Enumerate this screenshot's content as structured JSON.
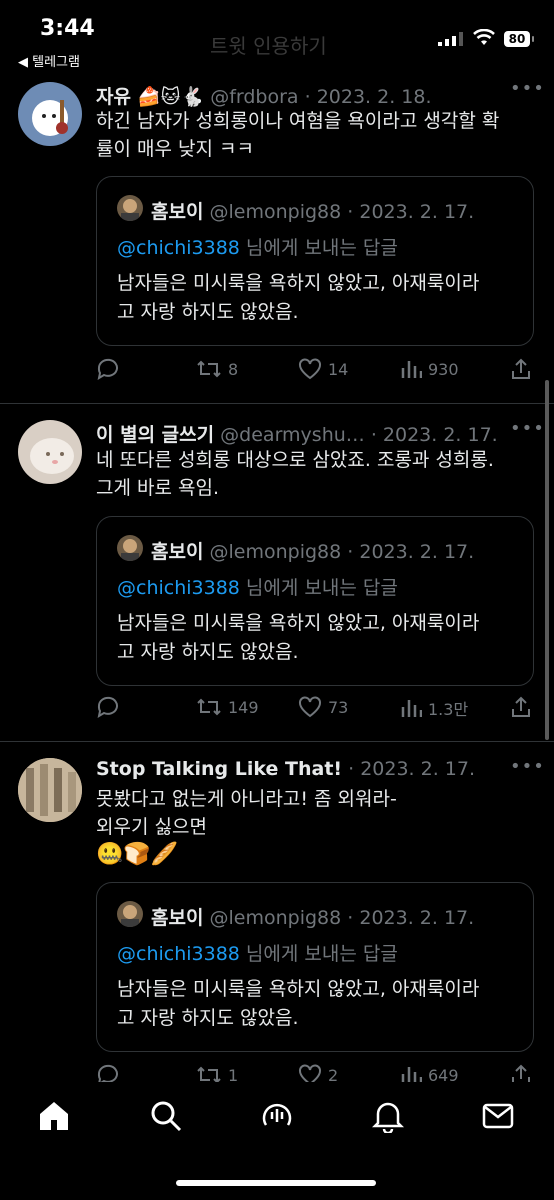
{
  "status_bar": {
    "time": "3:44",
    "back_app": "◀ 텔레그램",
    "battery": "80",
    "faded_title": "트윗 인용하기"
  },
  "tweets": [
    {
      "name": "자유",
      "name_emojis": "🍰🐱🐇",
      "handle": "@frdbora",
      "dot": " · ",
      "date": "2023. 2. 18.",
      "text_lines": [
        "하긴 남자가 성희롱이나 여혐을 욕이라고 생각할 확",
        "률이 매우 낮지 ㅋㅋ"
      ],
      "quote": {
        "name": "홈보이",
        "handle": "@lemonpig88",
        "date": "2023. 2. 17.",
        "mention": "@chichi3388",
        "reply_suffix": " 님에게 보내는 답글",
        "text_lines": [
          "남자들은 미시룩을 욕하지 않았고, 아재룩이라",
          "고 자랑 하지도 않았음."
        ]
      },
      "replies": "",
      "retweets": "8",
      "likes": "14",
      "views": "930"
    },
    {
      "name": "이 별의 글쓰기",
      "handle": "@dearmyshu…",
      "dot": " · ",
      "date": "2023. 2. 17.",
      "text_lines": [
        "네 또다른 성희롱 대상으로 삼았죠. 조롱과 성희롱.",
        "그게 바로 욕임."
      ],
      "quote": {
        "name": "홈보이",
        "handle": "@lemonpig88",
        "date": "2023. 2. 17.",
        "mention": "@chichi3388",
        "reply_suffix": " 님에게 보내는 답글",
        "text_lines": [
          "남자들은 미시룩을 욕하지 않았고, 아재룩이라",
          "고 자랑 하지도 않았음."
        ]
      },
      "replies": "",
      "retweets": "149",
      "likes": "73",
      "views": "1.3만"
    },
    {
      "name": "Stop Talking Like That!",
      "handle": "",
      "dot": " · ",
      "date": "2023. 2. 17.",
      "text_lines": [
        "못봤다고 없는게 아니라고! 좀 외워라-",
        "외우기 싫으면"
      ],
      "emoji_line": "🤐🍞🥖",
      "quote": {
        "name": "홈보이",
        "handle": "@lemonpig88",
        "date": "2023. 2. 17.",
        "mention": "@chichi3388",
        "reply_suffix": " 님에게 보내는 답글",
        "text_lines": [
          "남자들은 미시룩을 욕하지 않았고, 아재룩이라",
          "고 자랑 하지도 않았음."
        ]
      },
      "retweets": "1",
      "likes": "2",
      "views": "649"
    }
  ],
  "tabs": [
    "home-icon",
    "search-icon",
    "spaces-icon",
    "notifications-icon",
    "messages-icon"
  ],
  "colors": {
    "background": "#000000",
    "link": "#1d9bf0",
    "muted": "#71767b",
    "divider": "#2f3336"
  }
}
